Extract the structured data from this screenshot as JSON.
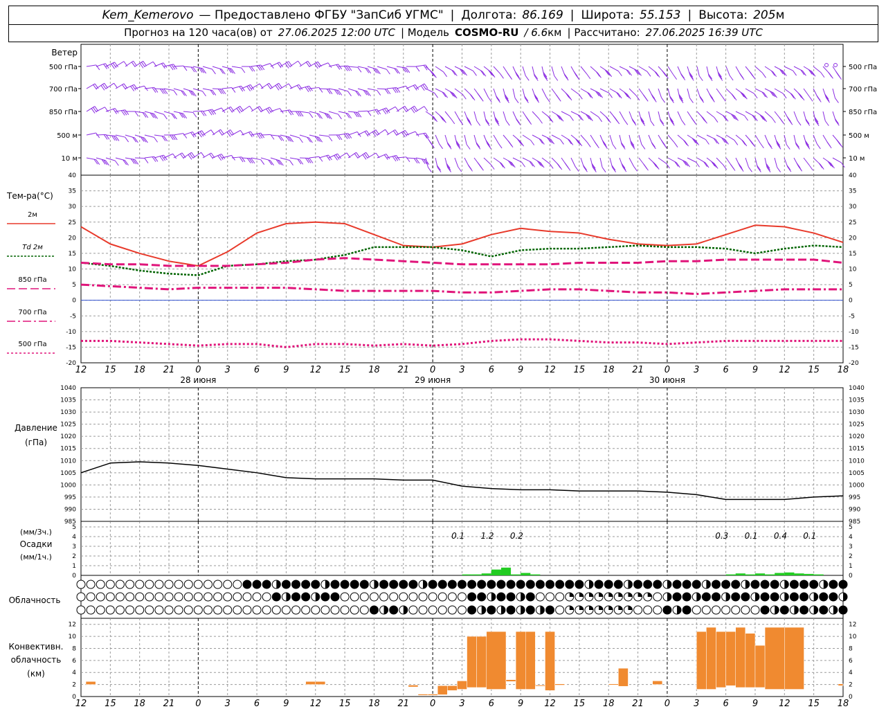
{
  "header": {
    "station": "Kem_Kemerovo",
    "provided_by": "— Предоставлено ФГБУ \"ЗапСиб УГМС\"",
    "lon_label": "Долгота:",
    "lon_value": "86.169",
    "lat_label": "Широта:",
    "lat_value": "55.153",
    "alt_label": "Высота:",
    "alt_value": "205",
    "alt_unit": "м",
    "forecast_label": "Прогноз на 120 часа(ов) от",
    "forecast_time": "27.06.2025 12:00 UTC",
    "model_label": "| Модель",
    "model_name": "COSMO-RU",
    "model_res": "/ 6.6",
    "model_res_unit": "км",
    "calc_label": "| Рассчитано:",
    "calc_time": "27.06.2025 16:39 UTC"
  },
  "colors": {
    "wind": "#8a2be2",
    "t2m": "#e8392a",
    "td2m": "#006400",
    "t850": "#e0147a",
    "t700": "#e0147a",
    "t500": "#e0147a",
    "precip": "#22cc22",
    "convective": "#f08a30",
    "grid": "#9a9a9a"
  },
  "x_axis": {
    "hour_ticks": [
      "12",
      "15",
      "18",
      "21",
      "0",
      "3",
      "6",
      "9",
      "12",
      "15",
      "18",
      "21",
      "0",
      "3",
      "6",
      "9",
      "12",
      "15",
      "18",
      "21",
      "0",
      "3",
      "6",
      "9",
      "12",
      "15",
      "18"
    ],
    "day_labels": [
      "28 июня",
      "29 июня",
      "30 июня"
    ]
  },
  "wind_panel": {
    "title": "Ветер",
    "levels": [
      "500 гПа",
      "700 гПа",
      "850 гПа",
      "500 м",
      "10 м"
    ]
  },
  "temp_panel": {
    "title": "Тем-ра(°С)",
    "legend": [
      "2м",
      "Td  2м",
      "850 гПа",
      "700 гПа",
      "500 гПа"
    ],
    "y_ticks": [
      "40",
      "35",
      "30",
      "25",
      "20",
      "15",
      "10",
      "5",
      "0",
      "-5",
      "-10",
      "-15",
      "-20"
    ]
  },
  "pressure_panel": {
    "title": "Давление",
    "unit": "(гПа)",
    "y_ticks": [
      "1040",
      "1035",
      "1030",
      "1025",
      "1020",
      "1015",
      "1010",
      "1005",
      "1000",
      "995",
      "990",
      "985"
    ]
  },
  "precip_panel": {
    "unit_3h": "(мм/3ч.)",
    "title": "Осадки",
    "unit_1h": "(мм/1ч.)",
    "y_ticks": [
      "5",
      "4",
      "3",
      "2",
      "1",
      "0"
    ],
    "totals": [
      "0.1",
      "1.2",
      "0.2",
      "0.3",
      "0.1",
      "0.4",
      "0.1"
    ]
  },
  "cloud_panel": {
    "title": "Облачность"
  },
  "conv_panel": {
    "title_1": "Конвективн.",
    "title_2": "облачность",
    "unit": "(км)",
    "y_ticks": [
      "12",
      "10",
      "8",
      "6",
      "4",
      "2",
      "0"
    ]
  },
  "chart_data": [
    {
      "type": "line",
      "title": "Тем-ра(°С)",
      "ylim": [
        -20,
        40
      ],
      "x_hours": [
        0,
        3,
        6,
        9,
        12,
        15,
        18,
        21,
        24,
        27,
        30,
        33,
        36,
        39,
        42,
        45,
        48,
        51,
        54,
        57,
        60,
        63,
        66,
        69,
        72,
        75,
        78
      ],
      "series": [
        {
          "name": "2м",
          "values": [
            23.5,
            18,
            15,
            12.5,
            11,
            15.5,
            21.5,
            24.5,
            25,
            24.5,
            21,
            17.5,
            17,
            18,
            21,
            23,
            22,
            21.5,
            19.5,
            18,
            17.5,
            18,
            21,
            24,
            23.5,
            21.5,
            18.5
          ]
        },
        {
          "name": "Td  2м",
          "values": [
            12,
            11,
            9.5,
            8.5,
            8,
            11,
            11.5,
            12.5,
            13,
            14.5,
            17,
            17,
            17,
            16,
            14,
            16,
            16.5,
            16.5,
            17,
            17.5,
            17,
            17,
            16.5,
            15,
            16.5,
            17.5,
            17
          ]
        },
        {
          "name": "850 гПа",
          "values": [
            12,
            11.5,
            11.5,
            11,
            11,
            11,
            11.5,
            12,
            13,
            13.5,
            13,
            12.5,
            12,
            11.5,
            11.5,
            11.5,
            11.5,
            12,
            12,
            12,
            12.5,
            12.5,
            13,
            13,
            13,
            13,
            12
          ]
        },
        {
          "name": "700 гПа",
          "values": [
            5,
            4.5,
            4,
            3.5,
            4,
            4,
            4,
            4,
            3.5,
            3,
            3,
            3,
            3,
            2.5,
            2.5,
            3,
            3.5,
            3.5,
            3,
            2.5,
            2.5,
            2,
            2.5,
            3,
            3.5,
            3.5,
            3.5
          ]
        },
        {
          "name": "500 гПа",
          "values": [
            -13,
            -13,
            -13.5,
            -14,
            -14.5,
            -14,
            -14,
            -15,
            -14,
            -14,
            -14.5,
            -14,
            -14.5,
            -14,
            -13,
            -12.5,
            -12.5,
            -13,
            -13.5,
            -13.5,
            -14,
            -13.5,
            -13,
            -13,
            -13,
            -13,
            -13
          ]
        }
      ]
    },
    {
      "type": "line",
      "title": "Давление",
      "ylim": [
        985,
        1040
      ],
      "x_hours": [
        0,
        3,
        6,
        9,
        12,
        15,
        18,
        21,
        24,
        27,
        30,
        33,
        36,
        39,
        42,
        45,
        48,
        51,
        54,
        57,
        60,
        63,
        66,
        69,
        72,
        75,
        78
      ],
      "series": [
        {
          "name": "Давление",
          "values": [
            1005,
            1009,
            1009.5,
            1009,
            1008,
            1006.5,
            1005,
            1003,
            1002.5,
            1002.5,
            1002.5,
            1002,
            1002,
            999.5,
            998.5,
            998,
            998,
            997.5,
            997.5,
            997.5,
            997,
            996,
            994,
            994,
            994,
            995,
            995.5
          ]
        }
      ]
    },
    {
      "type": "bar",
      "title": "Осадки",
      "ylim": [
        0,
        5
      ],
      "x_hours": [
        39,
        40,
        41,
        42,
        43,
        44,
        45,
        46,
        66,
        67,
        68,
        69,
        70,
        71,
        72,
        73,
        74,
        75
      ],
      "values": [
        0.1,
        0.1,
        0.2,
        0.6,
        0.8,
        0.1,
        0.25,
        0.1,
        0.1,
        0.2,
        0.1,
        0.2,
        0.1,
        0.25,
        0.3,
        0.2,
        0.15,
        0.1
      ]
    },
    {
      "type": "bar",
      "title": "Конвективн. облачность",
      "ylim": [
        0,
        12
      ],
      "bars": [
        {
          "x0": 0.5,
          "x1": 1.5,
          "bottom": 2.0,
          "top": 2.5
        },
        {
          "x0": 23,
          "x1": 24,
          "bottom": 2.0,
          "top": 2.5
        },
        {
          "x0": 24,
          "x1": 25,
          "bottom": 2.0,
          "top": 2.5
        },
        {
          "x0": 33.5,
          "x1": 34.5,
          "bottom": 1.6,
          "top": 1.9
        },
        {
          "x0": 34.5,
          "x1": 35.5,
          "bottom": 0.2,
          "top": 0.4
        },
        {
          "x0": 35.5,
          "x1": 36.5,
          "bottom": 0.2,
          "top": 0.4
        },
        {
          "x0": 36.5,
          "x1": 37.5,
          "bottom": 0.3,
          "top": 1.8
        },
        {
          "x0": 37.5,
          "x1": 38.5,
          "bottom": 1.0,
          "top": 1.8
        },
        {
          "x0": 38.5,
          "x1": 39.5,
          "bottom": 1.2,
          "top": 2.6
        },
        {
          "x0": 39.5,
          "x1": 40.5,
          "bottom": 1.5,
          "top": 10.0
        },
        {
          "x0": 40.5,
          "x1": 41.5,
          "bottom": 1.5,
          "top": 10.0
        },
        {
          "x0": 41.5,
          "x1": 43.5,
          "bottom": 1.2,
          "top": 10.8
        },
        {
          "x0": 43.5,
          "x1": 44.5,
          "bottom": 2.5,
          "top": 2.8
        },
        {
          "x0": 44.5,
          "x1": 45.5,
          "bottom": 1.2,
          "top": 10.8
        },
        {
          "x0": 45.5,
          "x1": 46.5,
          "bottom": 1.2,
          "top": 10.8
        },
        {
          "x0": 46.5,
          "x1": 47.5,
          "bottom": 1.8,
          "top": 1.9
        },
        {
          "x0": 47.5,
          "x1": 48.5,
          "bottom": 1.0,
          "top": 10.8
        },
        {
          "x0": 48.5,
          "x1": 49.5,
          "bottom": 1.9,
          "top": 2.1
        },
        {
          "x0": 54,
          "x1": 55,
          "bottom": 2.0,
          "top": 2.1
        },
        {
          "x0": 55,
          "x1": 56,
          "bottom": 1.7,
          "top": 4.7
        },
        {
          "x0": 58.5,
          "x1": 59.5,
          "bottom": 2.0,
          "top": 2.6
        },
        {
          "x0": 63,
          "x1": 64,
          "bottom": 1.2,
          "top": 10.8
        },
        {
          "x0": 64,
          "x1": 65,
          "bottom": 1.2,
          "top": 11.5
        },
        {
          "x0": 65,
          "x1": 66,
          "bottom": 1.5,
          "top": 10.8
        },
        {
          "x0": 66,
          "x1": 67,
          "bottom": 1.8,
          "top": 10.8
        },
        {
          "x0": 67,
          "x1": 68,
          "bottom": 1.5,
          "top": 11.5
        },
        {
          "x0": 68,
          "x1": 69,
          "bottom": 1.5,
          "top": 10.5
        },
        {
          "x0": 69,
          "x1": 70,
          "bottom": 1.5,
          "top": 8.5
        },
        {
          "x0": 70,
          "x1": 72,
          "bottom": 1.2,
          "top": 11.5
        },
        {
          "x0": 72,
          "x1": 74,
          "bottom": 1.2,
          "top": 11.5
        },
        {
          "x0": 77.5,
          "x1": 78,
          "bottom": 1.8,
          "top": 2.1
        }
      ]
    }
  ]
}
